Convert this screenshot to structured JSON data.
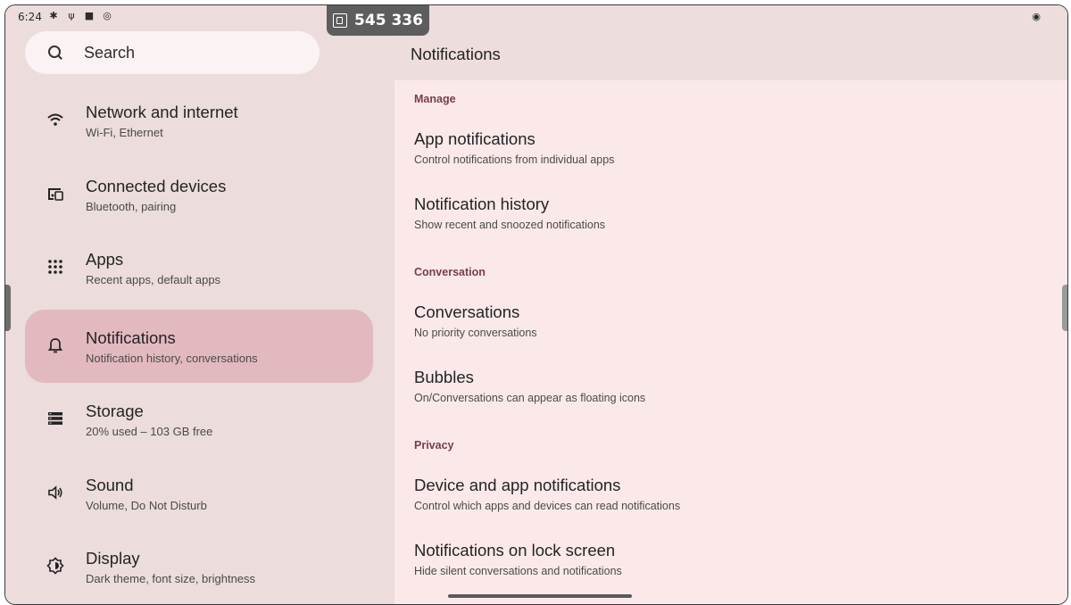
{
  "status_bar": {
    "time": "6:24",
    "badge_number": "545 336"
  },
  "search": {
    "placeholder": "Search"
  },
  "sidebar": {
    "items": [
      {
        "title": "Network and internet",
        "subtitle": "Wi-Fi, Ethernet",
        "icon": "wifi-icon"
      },
      {
        "title": "Connected devices",
        "subtitle": "Bluetooth, pairing",
        "icon": "devices-icon"
      },
      {
        "title": "Apps",
        "subtitle": "Recent apps, default apps",
        "icon": "apps-grid-icon"
      },
      {
        "title": "Notifications",
        "subtitle": "Notification history, conversations",
        "icon": "bell-icon",
        "selected": true
      },
      {
        "title": "Storage",
        "subtitle": "20% used – 103 GB free",
        "icon": "storage-icon"
      },
      {
        "title": "Sound",
        "subtitle": "Volume, Do Not Disturb",
        "icon": "volume-icon"
      },
      {
        "title": "Display",
        "subtitle": "Dark theme, font size, brightness",
        "icon": "display-icon"
      }
    ]
  },
  "page": {
    "title": "Notifications",
    "sections": [
      {
        "header": "Manage",
        "items": [
          {
            "title": "App notifications",
            "subtitle": "Control notifications from individual apps"
          },
          {
            "title": "Notification history",
            "subtitle": "Show recent and snoozed notifications"
          }
        ]
      },
      {
        "header": "Conversation",
        "items": [
          {
            "title": "Conversations",
            "subtitle": "No priority conversations"
          },
          {
            "title": "Bubbles",
            "subtitle": "On/Conversations can appear as floating icons"
          }
        ]
      },
      {
        "header": "Privacy",
        "items": [
          {
            "title": "Device and app notifications",
            "subtitle": "Control which apps and devices can read notifications"
          },
          {
            "title": "Notifications on lock screen",
            "subtitle": "Hide silent conversations and notifications"
          }
        ]
      }
    ]
  },
  "colors": {
    "selected_bg": "#e2b9bf",
    "section_header": "#7a3d49",
    "right_bg": "#fbe9ea",
    "left_bg": "#ecdcdc"
  }
}
